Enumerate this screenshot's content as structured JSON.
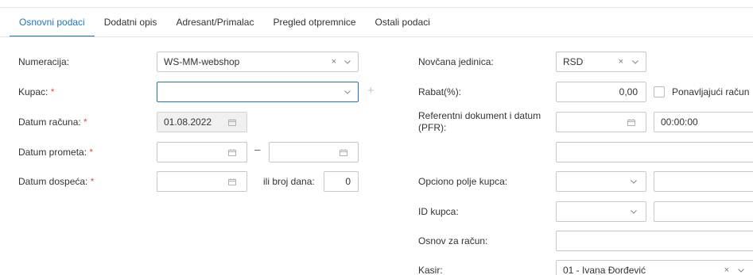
{
  "tabs": [
    {
      "label": "Osnovni podaci",
      "active": true
    },
    {
      "label": "Dodatni opis"
    },
    {
      "label": "Adresant/Primalac"
    },
    {
      "label": "Pregled otpremnice"
    },
    {
      "label": "Ostali podaci"
    }
  ],
  "left": {
    "numeracija": {
      "label": "Numeracija:",
      "value": "WS-MM-webshop"
    },
    "kupac": {
      "label": "Kupac:",
      "req": "*",
      "value": ""
    },
    "datum_racuna": {
      "label": "Datum računa:",
      "req": "*",
      "value": "01.08.2022"
    },
    "datum_prometa": {
      "label": "Datum prometa:",
      "req": "*",
      "dash": "–"
    },
    "datum_dospeca": {
      "label": "Datum dospeća:",
      "req": "*",
      "days_label": "ili broj dana:",
      "days_value": "0"
    }
  },
  "right": {
    "novcana": {
      "label": "Novčana jedinica:",
      "value": "RSD"
    },
    "rabat": {
      "label": "Rabat(%):",
      "value": "0,00",
      "checkbox_label": "Ponavljajući račun"
    },
    "referentni": {
      "label": "Referentni dokument i datum (PFR):",
      "time": "00:00:00"
    },
    "opciono": {
      "label": "Opciono polje kupca:"
    },
    "id_kupca": {
      "label": "ID kupca:"
    },
    "osnov": {
      "label": "Osnov za račun:"
    },
    "kasir": {
      "label": "Kasir:",
      "value": "01 - Ivana Đorđević"
    }
  },
  "icons": {
    "clear": "×",
    "plus": "+"
  },
  "colors": {
    "accent": "#1f74c0",
    "required": "#d9534f"
  }
}
